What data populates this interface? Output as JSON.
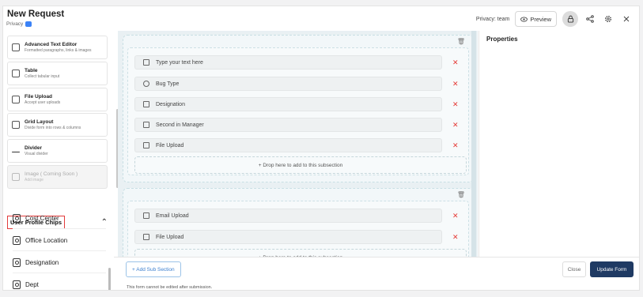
{
  "header": {
    "title": "New Request",
    "subtitle": "Privacy",
    "privacy_label": "Privacy: team",
    "preview_label": "Preview"
  },
  "widgets": [
    {
      "title": "Advanced Text Editor",
      "desc": "Formatted paragraphs, links & images",
      "icon": "rich-text-icon"
    },
    {
      "title": "Table",
      "desc": "Collect tabular input",
      "icon": "table-icon"
    },
    {
      "title": "File Upload",
      "desc": "Accept user uploads",
      "icon": "file-upload-icon"
    },
    {
      "title": "Grid Layout",
      "desc": "Divide form into rows & columns",
      "icon": "grid-icon"
    },
    {
      "title": "Divider",
      "desc": "Visual divider",
      "icon": "divider-icon"
    },
    {
      "title": "Image ( Coming Soon )",
      "desc": "Add image",
      "icon": "image-icon",
      "disabled": true
    }
  ],
  "chips_section": {
    "title": "User Profile Chips",
    "items": [
      "Cost Center",
      "Office Location",
      "Designation",
      "Dept"
    ]
  },
  "canvas": {
    "section1_fields": [
      {
        "label": "Type your text here",
        "icon": "text-icon"
      },
      {
        "label": "Bug Type",
        "icon": "dropdown-icon"
      },
      {
        "label": "Designation",
        "icon": "profile-chip-icon"
      },
      {
        "label": "Second in Manager",
        "icon": "profile-chip-icon"
      },
      {
        "label": "File Upload",
        "icon": "file-icon"
      }
    ],
    "drop_label": "+ Drop here to add to this subsection",
    "section2_fields": [
      {
        "label": "Email Upload",
        "icon": "text-icon"
      },
      {
        "label": "File Upload",
        "icon": "file-icon"
      }
    ]
  },
  "properties": {
    "title": "Properties"
  },
  "footer": {
    "add_sub_section": "+ Add Sub Section",
    "note": "This form cannot be edited after submission.",
    "close": "Close",
    "update": "Update Form"
  },
  "colors": {
    "accent": "#1f3a63",
    "delete": "#e53935",
    "highlight": "#e23b3b"
  }
}
